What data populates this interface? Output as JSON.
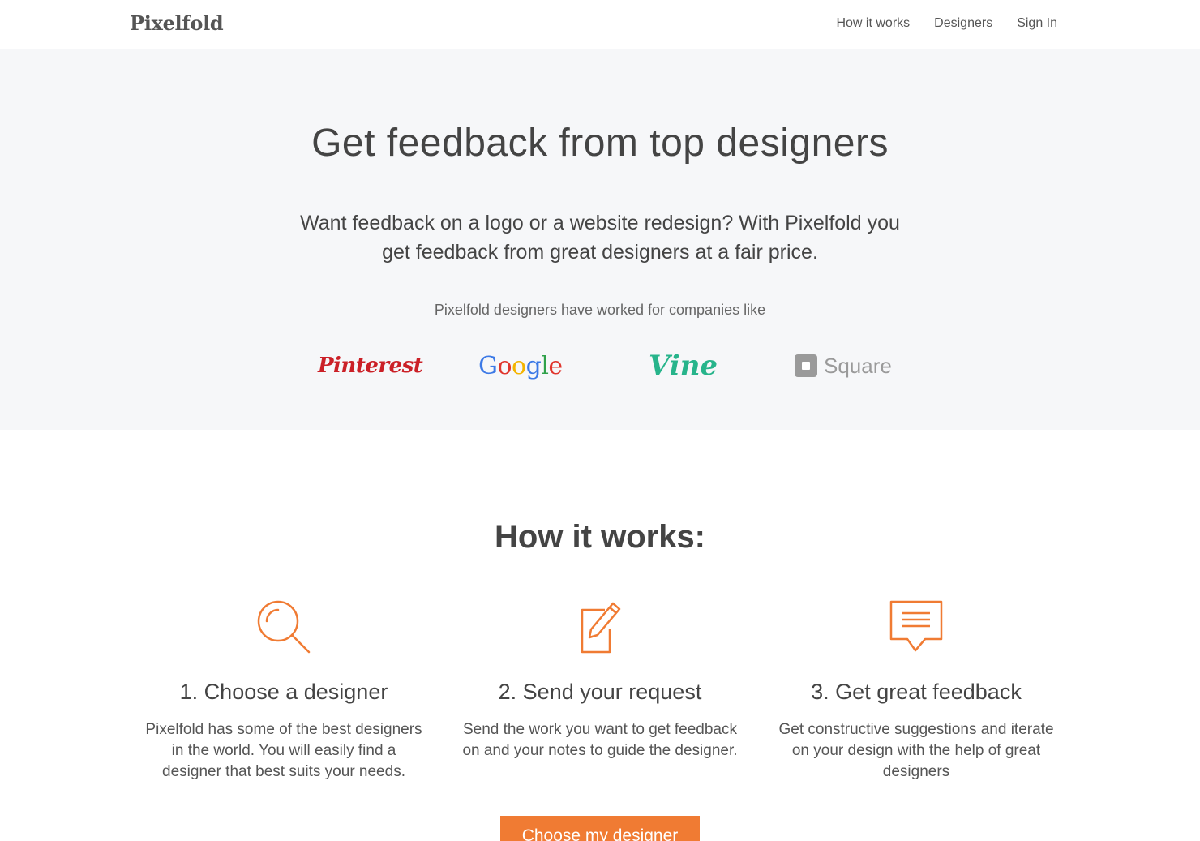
{
  "header": {
    "brand": "Pixelfold",
    "nav": [
      {
        "label": "How it works"
      },
      {
        "label": "Designers"
      },
      {
        "label": "Sign In"
      }
    ]
  },
  "hero": {
    "title": "Get feedback from top designers",
    "subtitle": "Want feedback on a logo or a website redesign? With Pixelfold you get feedback from great designers at a fair price.",
    "companies_intro": "Pixelfold designers have worked for companies like",
    "companies": {
      "pinterest": "Pinterest",
      "google": [
        "G",
        "o",
        "o",
        "g",
        "l",
        "e"
      ],
      "vine": "Vine",
      "square": "Square"
    },
    "background_color": "#f6f7f9"
  },
  "how": {
    "title": "How it works:",
    "steps": [
      {
        "icon": "magnifier-icon",
        "heading": "1. Choose a designer",
        "text": "Pixelfold has some of the best designers in the world. You will easily find a designer that best suits your needs."
      },
      {
        "icon": "edit-note-icon",
        "heading": "2. Send your request",
        "text": "Send the work you want to get feedback on and your notes to guide the designer."
      },
      {
        "icon": "speech-bubble-icon",
        "heading": "3. Get great feedback",
        "text": "Get constructive suggestions and iterate on your design with the help of great designers"
      }
    ],
    "cta_label": "Choose my designer",
    "accent_color": "#f07b33"
  }
}
